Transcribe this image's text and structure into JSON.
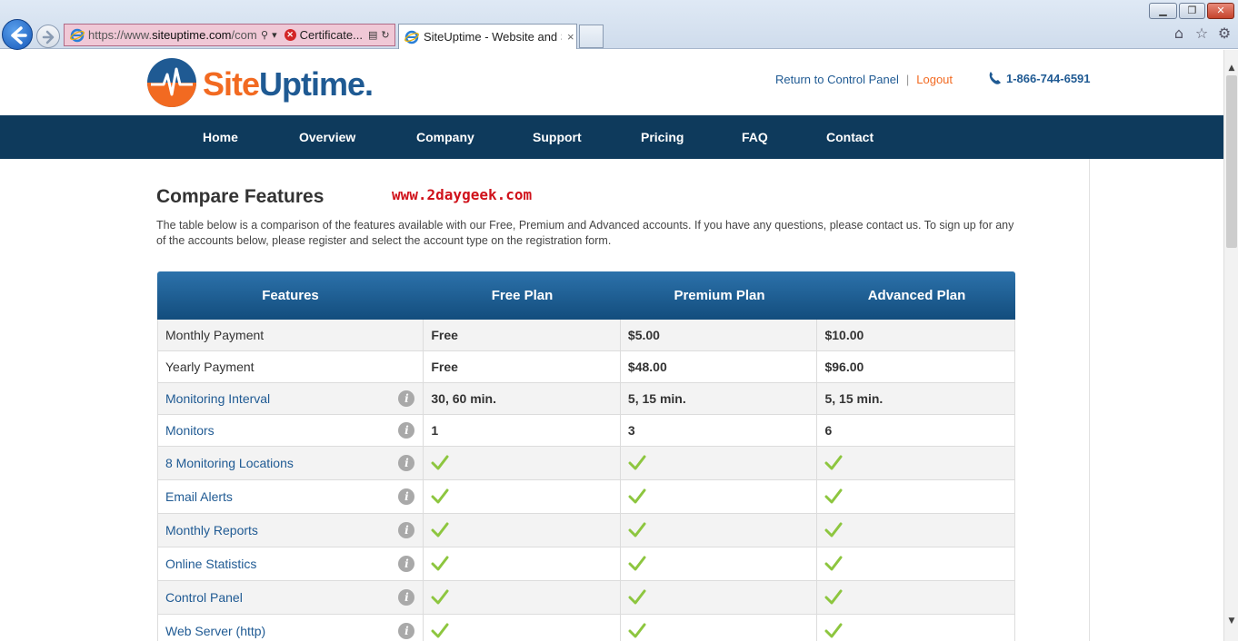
{
  "browser": {
    "address_url_prefix": "https://www.",
    "address_url_domain": "siteuptime.com",
    "address_url_suffix": "/com",
    "certificate_label": "Certificate...",
    "tab_title": "SiteUptime - Website and S...",
    "tab_close": "×",
    "win_min": "▁",
    "win_max": "❐",
    "win_close": "✕"
  },
  "header": {
    "logo_site": "Site",
    "logo_uptime": "Uptime",
    "logo_dot": ".",
    "return_link": "Return to Control Panel",
    "separator": "|",
    "logout_link": "Logout",
    "phone": "1-866-744-6591"
  },
  "menu": [
    {
      "label": "Home"
    },
    {
      "label": "Overview"
    },
    {
      "label": "Company"
    },
    {
      "label": "Support"
    },
    {
      "label": "Pricing"
    },
    {
      "label": "FAQ"
    },
    {
      "label": "Contact"
    }
  ],
  "main": {
    "title": "Compare Features",
    "watermark": "www.2daygeek.com",
    "intro": "The table below is a comparison of the features available with our Free, Premium and Advanced accounts. If you have any questions, please contact us. To sign up for any of the accounts below, please register and select the account type on the registration form."
  },
  "table": {
    "headers": [
      "Features",
      "Free Plan",
      "Premium Plan",
      "Advanced Plan"
    ],
    "rows": [
      {
        "feature": "Monthly Payment",
        "link": false,
        "info": false,
        "values": [
          "Free",
          "$5.00",
          "$10.00"
        ]
      },
      {
        "feature": "Yearly Payment",
        "link": false,
        "info": false,
        "values": [
          "Free",
          "$48.00",
          "$96.00"
        ]
      },
      {
        "feature": "Monitoring Interval",
        "link": true,
        "info": true,
        "values": [
          "30, 60 min.",
          "5, 15 min.",
          "5, 15 min."
        ]
      },
      {
        "feature": "Monitors",
        "link": true,
        "info": true,
        "values": [
          "1",
          "3",
          "6"
        ]
      },
      {
        "feature": "8 Monitoring Locations",
        "link": true,
        "info": true,
        "values": [
          "check",
          "check",
          "check"
        ]
      },
      {
        "feature": "Email Alerts",
        "link": true,
        "info": true,
        "values": [
          "check",
          "check",
          "check"
        ]
      },
      {
        "feature": "Monthly Reports",
        "link": true,
        "info": true,
        "values": [
          "check",
          "check",
          "check"
        ]
      },
      {
        "feature": "Online Statistics",
        "link": true,
        "info": true,
        "values": [
          "check",
          "check",
          "check"
        ]
      },
      {
        "feature": "Control Panel",
        "link": true,
        "info": true,
        "values": [
          "check",
          "check",
          "check"
        ]
      },
      {
        "feature": "Web Server (http)",
        "link": true,
        "info": true,
        "values": [
          "check",
          "check",
          "check"
        ]
      }
    ]
  },
  "icons": {
    "info": "i",
    "check_color": "#8dc63f",
    "brand_orange": "#f26a21",
    "brand_blue": "#1f5a93",
    "nav_bg": "#0e3a5c"
  }
}
